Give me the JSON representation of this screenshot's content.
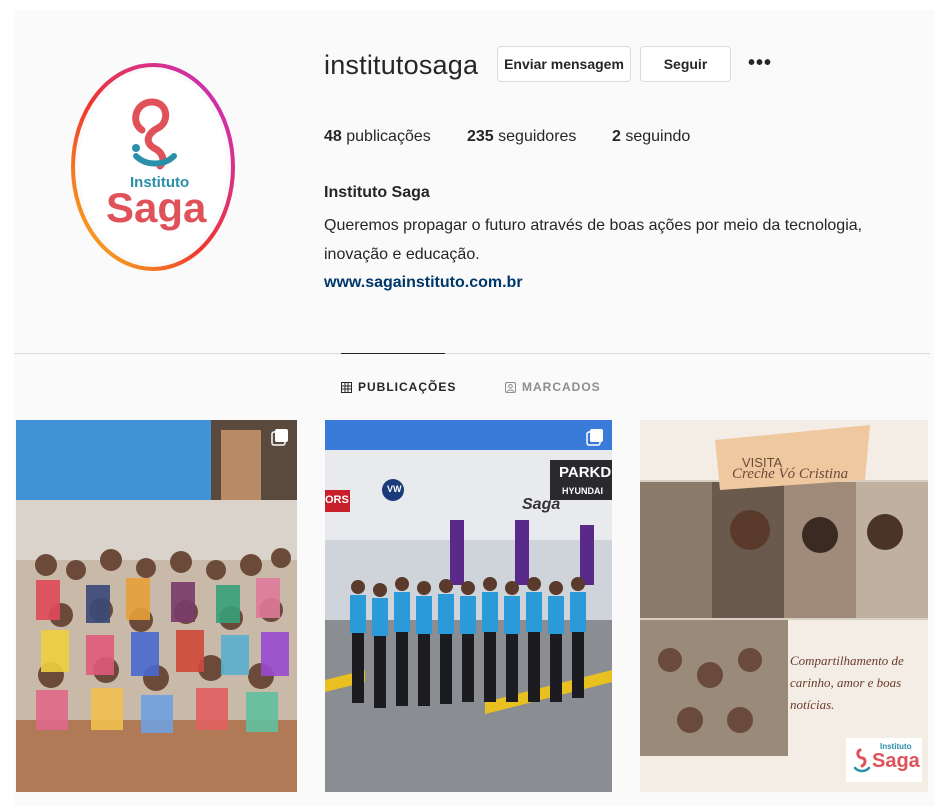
{
  "profile": {
    "username": "institutosaga",
    "full_name": "Instituto Saga",
    "bio": "Queremos propagar o futuro através de boas ações por meio da tecnologia, inovação e educação.",
    "website": "www.sagainstituto.com.br",
    "logo_text_top": "Instituto",
    "logo_text_bottom": "Saga"
  },
  "actions": {
    "message_label": "Enviar mensagem",
    "follow_label": "Seguir",
    "more_label": "•••"
  },
  "stats": {
    "posts_count": "48",
    "posts_label": "publicações",
    "followers_count": "235",
    "followers_label": "seguidores",
    "following_count": "2",
    "following_label": "seguindo"
  },
  "tabs": {
    "posts_label": "PUBLICAÇÕES",
    "tagged_label": "MARCADOS"
  },
  "posts": {
    "post2": {
      "sign_vw": "VW",
      "sign_saga": "Saga",
      "sign_park": "PARKDES",
      "sign_hyundai": "HYUNDAI",
      "sign_ors": "ORS"
    },
    "post3": {
      "visit_small": "VISITA",
      "visit_name": "Creche Vó Cristina",
      "caption_1": "Compartilhamento de",
      "caption_2": "carinho, amor e boas",
      "caption_3": "notícias.",
      "logo_top": "Instituto",
      "logo_bottom": "Saga"
    }
  },
  "colors": {
    "link": "#00376b",
    "brand_red": "#e0525a",
    "brand_teal": "#2a8fa8"
  }
}
